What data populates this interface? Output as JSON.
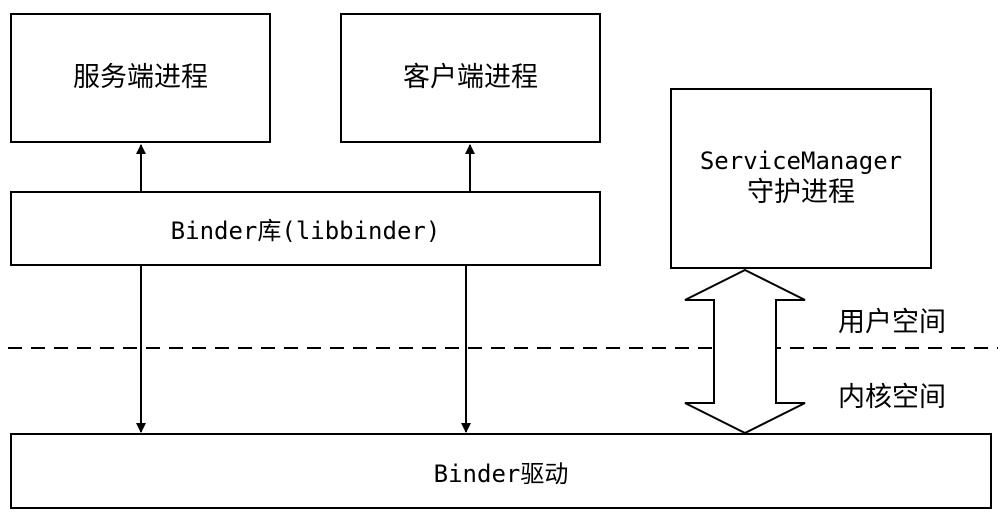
{
  "nodes": {
    "server_process": "服务端进程",
    "client_process": "客户端进程",
    "binder_library": "Binder库(libbinder)",
    "service_manager_line1": "ServiceManager",
    "service_manager_line2": "守护进程",
    "binder_driver": "Binder驱动"
  },
  "regions": {
    "user_space": "用户空间",
    "kernel_space": "内核空间"
  },
  "edges": [
    {
      "from": "binder_library",
      "to": "server_process",
      "style": "arrow"
    },
    {
      "from": "binder_library",
      "to": "client_process",
      "style": "arrow"
    },
    {
      "from": "binder_library",
      "to": "binder_driver",
      "style": "arrow"
    },
    {
      "from": "binder_library",
      "to": "binder_driver",
      "style": "arrow"
    },
    {
      "from": "service_manager",
      "to": "binder_driver",
      "style": "double-hollow-arrow"
    }
  ],
  "colors": {
    "stroke": "#000000",
    "background": "#ffffff"
  }
}
